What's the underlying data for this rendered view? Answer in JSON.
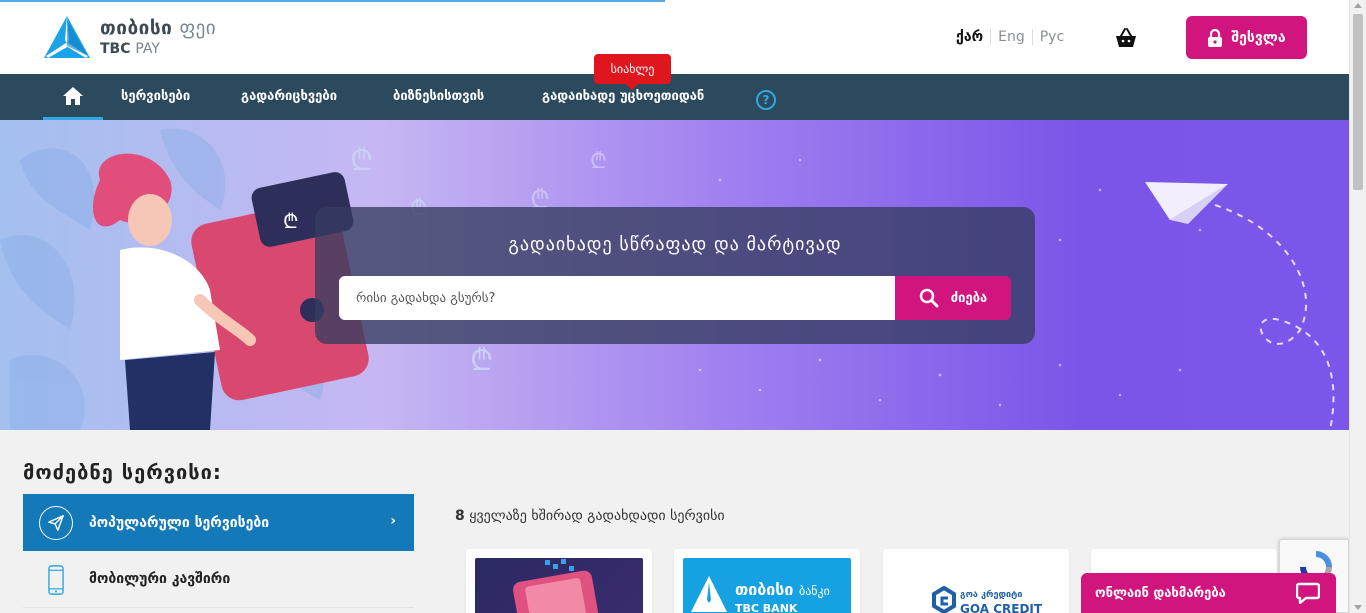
{
  "header": {
    "logo_line1_bold": "თიბისი",
    "logo_line1_light": "ფეი",
    "logo_line2_bold": "TBC",
    "logo_line2_light": "PAY",
    "languages": [
      "ქარ",
      "Eng",
      "Рус"
    ],
    "active_language": "ქარ",
    "login_label": "შესვლა",
    "icons": {
      "basket": "basket-icon",
      "lock": "lock-icon"
    },
    "brand_color": "#d1147e"
  },
  "nav": {
    "items": [
      "სერვისები",
      "გადარიცხვები",
      "ბიზნესისთვის",
      "გადაიხადე უცხოეთიდან"
    ],
    "new_badge": "სიახლე",
    "help_symbol": "?",
    "icons": {
      "home": "home-icon"
    },
    "background": "#2b4a5d",
    "accent": "#2fa8e3"
  },
  "hero": {
    "title": "გადაიხადე სწრაფად და მარტივად",
    "search_placeholder": "რისი გადახდა გსურს?",
    "search_button": "ძიება",
    "icons": {
      "search": "search-icon"
    }
  },
  "services": {
    "title": "მოძებნე სერვისი:",
    "categories": [
      {
        "label": "პოპულარული სერვისები",
        "icon": "paper-plane-icon",
        "active": true
      },
      {
        "label": "მობილური კავშირი",
        "icon": "mobile-phone-icon",
        "active": false
      }
    ],
    "freq_count": "8",
    "freq_text": "ყველაზე ხშირად გადახდადი სერვისი",
    "cards": [
      {
        "name": "phone-wallet"
      },
      {
        "name": "tbc-bank",
        "text_geo_bold": "თიბისი",
        "text_geo_light": "ბანკი",
        "text_en": "TBC BANK"
      },
      {
        "name": "goa-credit",
        "text_geo": "გოა კრედიტი",
        "text_en": "GOA CREDIT"
      },
      {
        "name": "blank"
      }
    ]
  },
  "chat": {
    "label": "ონლაინ დახმარება",
    "icon": "chat-bubble-icon"
  }
}
